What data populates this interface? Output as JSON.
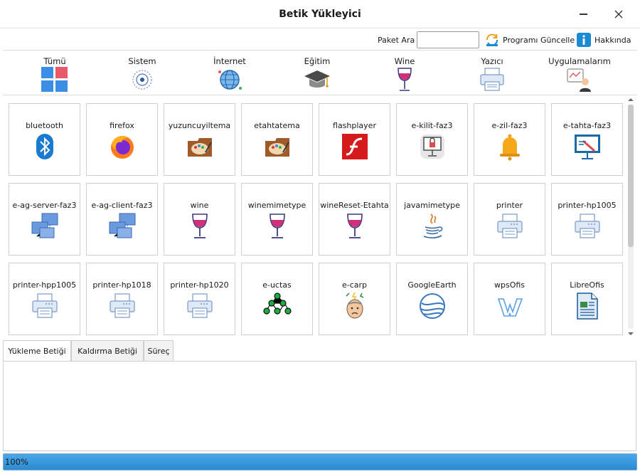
{
  "window": {
    "title": "Betik Yükleyici"
  },
  "toolbar": {
    "search_label": "Paket Ara",
    "search_value": "",
    "update_label": "Programı Güncelle",
    "about_label": "Hakkında",
    "accent": "#1a8ad4"
  },
  "categories": [
    {
      "label": "Tümü",
      "icon": "grid-icon"
    },
    {
      "label": "Sistem",
      "icon": "system-icon"
    },
    {
      "label": "İnternet",
      "icon": "globe-icon"
    },
    {
      "label": "Eğitim",
      "icon": "graduation-cap-icon"
    },
    {
      "label": "Wine",
      "icon": "wine-glass-icon"
    },
    {
      "label": "Yazıcı",
      "icon": "printer-icon"
    },
    {
      "label": "Uygulamalarım",
      "icon": "my-apps-icon"
    }
  ],
  "packages": [
    {
      "label": "bluetooth",
      "icon": "bluetooth"
    },
    {
      "label": "firefox",
      "icon": "firefox"
    },
    {
      "label": "yuzuncuyiltema",
      "icon": "palette"
    },
    {
      "label": "etahtatema",
      "icon": "palette"
    },
    {
      "label": "flashplayer",
      "icon": "flash"
    },
    {
      "label": "e-kilit-faz3",
      "icon": "lock"
    },
    {
      "label": "e-zil-faz3",
      "icon": "bell"
    },
    {
      "label": "e-tahta-faz3",
      "icon": "whiteboard"
    },
    {
      "label": "e-ag-server-faz3",
      "icon": "network"
    },
    {
      "label": "e-ag-client-faz3",
      "icon": "network"
    },
    {
      "label": "wine",
      "icon": "wine"
    },
    {
      "label": "winemimetype",
      "icon": "wine"
    },
    {
      "label": "wineReset-Etahta",
      "icon": "wine"
    },
    {
      "label": "javamimetype",
      "icon": "java"
    },
    {
      "label": "printer",
      "icon": "printer"
    },
    {
      "label": "printer-hp1005",
      "icon": "printer"
    },
    {
      "label": "printer-hpp1005",
      "icon": "printer"
    },
    {
      "label": "printer-hp1018",
      "icon": "printer"
    },
    {
      "label": "printer-hp1020",
      "icon": "printer"
    },
    {
      "label": "e-uctas",
      "icon": "dots"
    },
    {
      "label": "e-carp",
      "icon": "person"
    },
    {
      "label": "GoogleEarth",
      "icon": "earth"
    },
    {
      "label": "wpsOfis",
      "icon": "wps"
    },
    {
      "label": "LibreOfis",
      "icon": "libre"
    }
  ],
  "tabs": [
    {
      "label": "Yükleme Betiği",
      "active": true
    },
    {
      "label": "Kaldırma Betiği",
      "active": false
    },
    {
      "label": "Süreç",
      "active": false
    }
  ],
  "progress": {
    "value": 100,
    "text": "100%"
  }
}
